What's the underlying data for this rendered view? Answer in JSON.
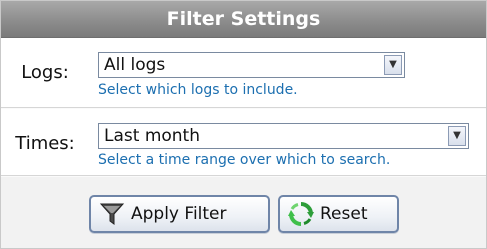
{
  "header": {
    "title": "Filter Settings"
  },
  "logs": {
    "label": "Logs:",
    "selected": "All logs",
    "hint": "Select which logs to include."
  },
  "times": {
    "label": "Times:",
    "selected": "Last month",
    "hint": "Select a time range over which to search."
  },
  "buttons": {
    "apply_label": "Apply Filter",
    "reset_label": "Reset",
    "apply_icon": "funnel-icon",
    "reset_icon": "refresh-icon"
  },
  "colors": {
    "header_bg": "#8d8d8d",
    "hint_text": "#1c6fb0",
    "button_border": "#6f85a8"
  }
}
